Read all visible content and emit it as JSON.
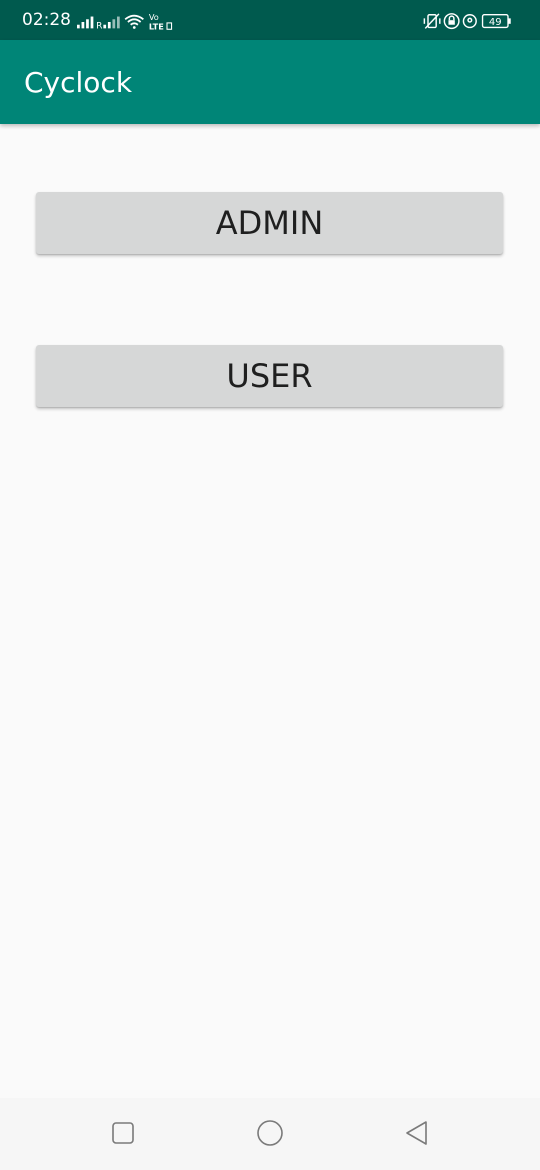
{
  "status_bar": {
    "time": "02:28",
    "battery": "49",
    "signal_icon": "signal-bars-icon",
    "wifi_icon": "wifi-icon",
    "volte_label": "Vo LTE",
    "right_icons": [
      "vibrate-icon",
      "lock-icon",
      "location-icon",
      "battery-icon"
    ]
  },
  "app_bar": {
    "title": "Cyclock",
    "color": "#008577"
  },
  "main": {
    "admin_button_label": "ADMIN",
    "user_button_label": "USER"
  },
  "nav_bar": {
    "icons": [
      "recent-apps-icon",
      "home-icon",
      "back-icon"
    ]
  }
}
